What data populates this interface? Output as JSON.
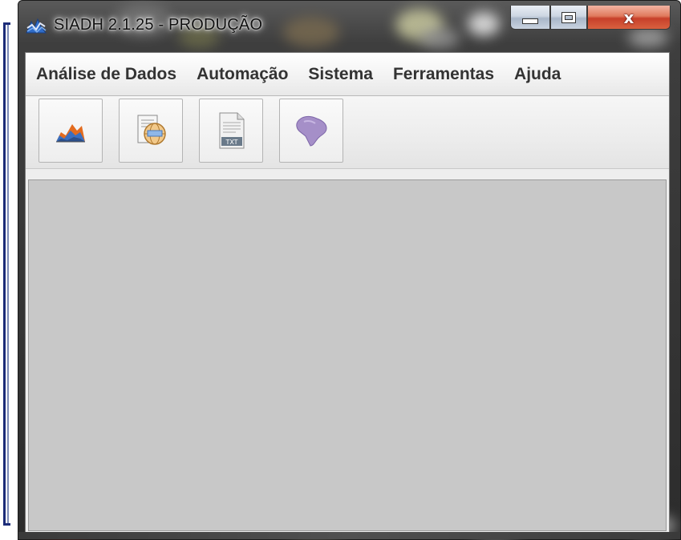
{
  "window": {
    "title": "SIADH  2.1.25  -  PRODUÇÃO",
    "app_icon": "siadh-logo-icon",
    "caption_buttons": {
      "minimize": "minimize-icon",
      "maximize": "maximize-icon",
      "close": "x"
    }
  },
  "menu": {
    "items": [
      {
        "label": "Análise de Dados"
      },
      {
        "label": "Automação"
      },
      {
        "label": "Sistema"
      },
      {
        "label": "Ferramentas"
      },
      {
        "label": "Ajuda"
      }
    ]
  },
  "toolbar": {
    "buttons": [
      {
        "icon": "area-chart-icon"
      },
      {
        "icon": "globe-document-icon"
      },
      {
        "icon": "txt-file-icon",
        "text": "TXT"
      },
      {
        "icon": "brazil-map-icon"
      }
    ]
  },
  "colors": {
    "content_bg": "#c8c8c8",
    "menu_text": "#333333",
    "close_button": "#c7402a"
  }
}
